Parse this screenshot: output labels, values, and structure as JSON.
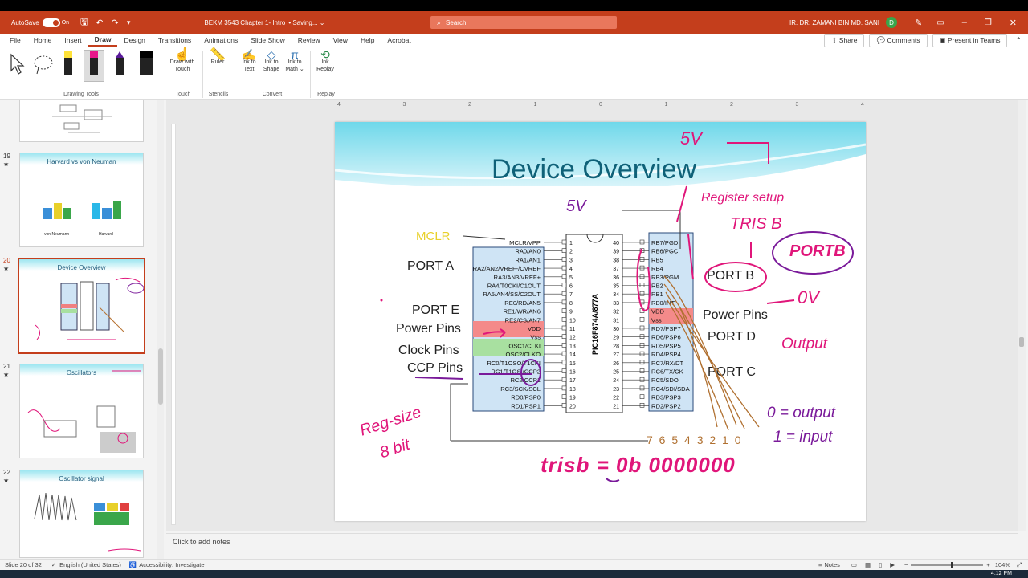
{
  "titlebar": {
    "autosave": "AutoSave",
    "toggle": "On",
    "filename": "BEKM 3543 Chapter 1- Intro",
    "saving": "• Saving... ⌄",
    "search_placeholder": "Search",
    "user_name": "IR. DR. ZAMANI BIN MD. SANI",
    "avatar_initial": "D",
    "accent": "#c43e1c"
  },
  "menu": {
    "items": [
      "File",
      "Home",
      "Insert",
      "Draw",
      "Design",
      "Transitions",
      "Animations",
      "Slide Show",
      "Review",
      "View",
      "Help",
      "Acrobat"
    ],
    "active": "Draw",
    "share": "Share",
    "comments": "Comments",
    "present": "Present in Teams"
  },
  "ribbon": {
    "draw_with_touch": "Draw with Touch",
    "ruler": "Ruler",
    "ink_to_text": "Ink to Text",
    "ink_to_shape": "Ink to Shape",
    "ink_to_math": "Ink to Math ⌄",
    "ink_replay": "Ink Replay",
    "groups": [
      "Drawing Tools",
      "Touch",
      "Stencils",
      "Convert",
      "Replay"
    ]
  },
  "thumbnails": [
    {
      "num": "19",
      "title": "Harvard vs von Neuman",
      "labels": [
        "von Neumann",
        "Harvard"
      ]
    },
    {
      "num": "20",
      "title": "Device Overview"
    },
    {
      "num": "21",
      "title": "Oscillators"
    },
    {
      "num": "22",
      "title": "Oscillator signal"
    }
  ],
  "ruler_ticks": [
    "4",
    "3",
    "2",
    "1",
    "0",
    "1",
    "2",
    "3",
    "4"
  ],
  "slide": {
    "title": "Device Overview",
    "mclr": "MCLR",
    "port_a": "PORT A",
    "port_e": "PORT E",
    "power_pins_left": "Power Pins",
    "clock_pins": "Clock Pins",
    "ccp_pins": "CCP Pins",
    "port_b": "PORT B",
    "power_pins_right": "Power Pins",
    "port_d": "PORT D",
    "port_c": "PORT C",
    "chip_name": "PIC16F874A/877A",
    "left_pins": [
      {
        "name": "MCLR/VPP",
        "num": "1"
      },
      {
        "name": "RA0/AN0",
        "num": "2"
      },
      {
        "name": "RA1/AN1",
        "num": "3"
      },
      {
        "name": "RA2/AN2/VREF-/CVREF",
        "num": "4"
      },
      {
        "name": "RA3/AN3/VREF+",
        "num": "5"
      },
      {
        "name": "RA4/T0CKI/C1OUT",
        "num": "6"
      },
      {
        "name": "RA5/AN4/SS/C2OUT",
        "num": "7"
      },
      {
        "name": "RE0/RD/AN5",
        "num": "8"
      },
      {
        "name": "RE1/WR/AN6",
        "num": "9"
      },
      {
        "name": "RE2/CS/AN7",
        "num": "10"
      },
      {
        "name": "VDD",
        "num": "11"
      },
      {
        "name": "Vss",
        "num": "12"
      },
      {
        "name": "OSC1/CLKI",
        "num": "13"
      },
      {
        "name": "OSC2/CLKO",
        "num": "14"
      },
      {
        "name": "RC0/T1OSO/T1CKI",
        "num": "15"
      },
      {
        "name": "RC1/T1OSI/CCP2",
        "num": "16"
      },
      {
        "name": "RC2/CCP1",
        "num": "17"
      },
      {
        "name": "RC3/SCK/SCL",
        "num": "18"
      },
      {
        "name": "RD0/PSP0",
        "num": "19"
      },
      {
        "name": "RD1/PSP1",
        "num": "20"
      }
    ],
    "right_pins": [
      {
        "name": "RB7/PGD",
        "num": "40"
      },
      {
        "name": "RB6/PGC",
        "num": "39"
      },
      {
        "name": "RB5",
        "num": "38"
      },
      {
        "name": "RB4",
        "num": "37"
      },
      {
        "name": "RB3/PGM",
        "num": "36"
      },
      {
        "name": "RB2",
        "num": "35"
      },
      {
        "name": "RB1",
        "num": "34"
      },
      {
        "name": "RB0/INT",
        "num": "33"
      },
      {
        "name": "VDD",
        "num": "32"
      },
      {
        "name": "Vss",
        "num": "31"
      },
      {
        "name": "RD7/PSP7",
        "num": "30"
      },
      {
        "name": "RD6/PSP6",
        "num": "29"
      },
      {
        "name": "RD5/PSP5",
        "num": "28"
      },
      {
        "name": "RD4/PSP4",
        "num": "27"
      },
      {
        "name": "RC7/RX/DT",
        "num": "26"
      },
      {
        "name": "RC6/TX/CK",
        "num": "25"
      },
      {
        "name": "RC5/SDO",
        "num": "24"
      },
      {
        "name": "RC4/SDI/SDA",
        "num": "23"
      },
      {
        "name": "RD3/PSP3",
        "num": "22"
      },
      {
        "name": "RD2/PSP2",
        "num": "21"
      }
    ],
    "ink": {
      "v5_top": "5V",
      "v5_mid": "5V",
      "register_setup": "Register setup",
      "trisb": "TRIS B",
      "portb": "PORTB",
      "zero_v": "0V",
      "output": "Output",
      "zero_output": "0 = output",
      "one_input": "1 = input",
      "bit_numbers": "7 6 5 4 3 2 1 0",
      "reg_size": "Reg-size",
      "eight_bit": "8 bit",
      "trisb_value": "trisb = 0b 0000000"
    }
  },
  "notes_placeholder": "Click to add notes",
  "status": {
    "slide": "Slide 20 of 32",
    "language": "English (United States)",
    "accessibility": "Accessibility: Investigate",
    "notes": "Notes",
    "zoom": "104%",
    "time": "4:12 PM"
  }
}
